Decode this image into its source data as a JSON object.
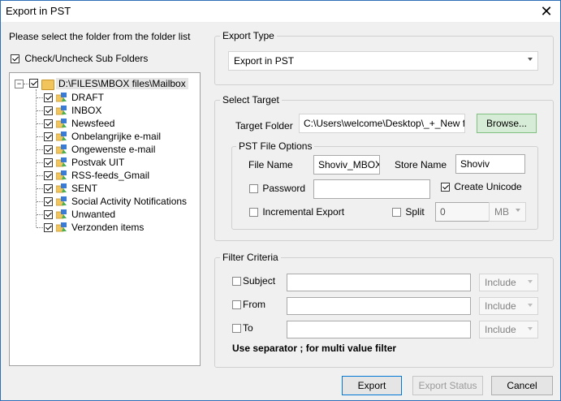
{
  "window": {
    "title": "Export in PST"
  },
  "left": {
    "instruction": "Please select the folder from the folder list",
    "check_sub_label": "Check/Uncheck Sub Folders",
    "tree": {
      "expander_symbol": "−",
      "root_label": "D:\\FILES\\MBOX files\\Mailbox",
      "items": [
        "DRAFT",
        "INBOX",
        "Newsfeed",
        "Onbelangrijke e-mail",
        "Ongewenste e-mail",
        "Postvak UIT",
        "RSS-feeds_Gmail",
        "SENT",
        "Social Activity Notifications",
        "Unwanted",
        "Verzonden items"
      ]
    }
  },
  "export_type": {
    "group_title": "Export Type",
    "selected": "Export in PST"
  },
  "target": {
    "group_title": "Select Target",
    "folder_label": "Target Folder",
    "folder_value": "C:\\Users\\welcome\\Desktop\\_+_New fold",
    "browse_label": "Browse...",
    "options": {
      "group_title": "PST File Options",
      "file_name_label": "File Name",
      "file_name_value": "Shoviv_MBOX_",
      "store_name_label": "Store Name",
      "store_name_value": "Shoviv",
      "password_label": "Password",
      "password_value": "",
      "create_unicode_label": "Create Unicode",
      "incremental_label": "Incremental Export",
      "split_label": "Split",
      "split_value": "0",
      "split_unit": "MB"
    }
  },
  "filter": {
    "group_title": "Filter Criteria",
    "rows": [
      {
        "label": "Subject",
        "value": "",
        "mode": "Include"
      },
      {
        "label": "From",
        "value": "",
        "mode": "Include"
      },
      {
        "label": "To",
        "value": "",
        "mode": "Include"
      }
    ],
    "note": "Use separator ; for multi value filter"
  },
  "buttons": {
    "export": "Export",
    "export_status": "Export Status",
    "cancel": "Cancel"
  },
  "colors": {
    "window_border": "#2f6fb8",
    "browse_bg": "#d6ecd6",
    "primary_border": "#0078d7"
  }
}
